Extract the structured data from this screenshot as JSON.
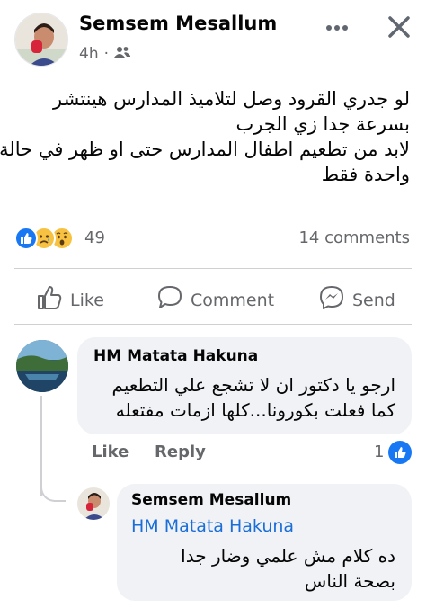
{
  "post": {
    "author": "Semsem Mesallum",
    "time": "4h",
    "separator": "·",
    "audience_icon": "friends-icon",
    "text_lines": [
      "لو جدري القرود وصل لتلاميذ المدارس هينتشر",
      "بسرعة جدا زي الجرب",
      "لابد من تطعيم اطفال المدارس حتى او ظهر في حالة",
      "واحدة فقط"
    ],
    "reactions": [
      "like",
      "sad",
      "wow"
    ],
    "reaction_count": "49",
    "comments_count": "14 comments"
  },
  "actions": {
    "like": "Like",
    "comment": "Comment",
    "send": "Send"
  },
  "comment": {
    "author": "HM Matata Hakuna",
    "text_lines": [
      "ارجو يا دكتور ان لا تشجع علي التطعيم",
      "كما فعلت بكورونا...كلها ازمات مفتعله"
    ],
    "like_label": "Like",
    "reply_label": "Reply",
    "reaction_count": "1"
  },
  "reply": {
    "author": "Semsem Mesallum",
    "mention": "HM Matata Hakuna",
    "text_lines": [
      "ده كلام مش علمي وضار جدا",
      "بصحة الناس"
    ]
  },
  "colors": {
    "accent": "#1877f2",
    "secondary_text": "#65676b",
    "bubble": "#f0f2f5",
    "mention": "#1a6ed8"
  }
}
